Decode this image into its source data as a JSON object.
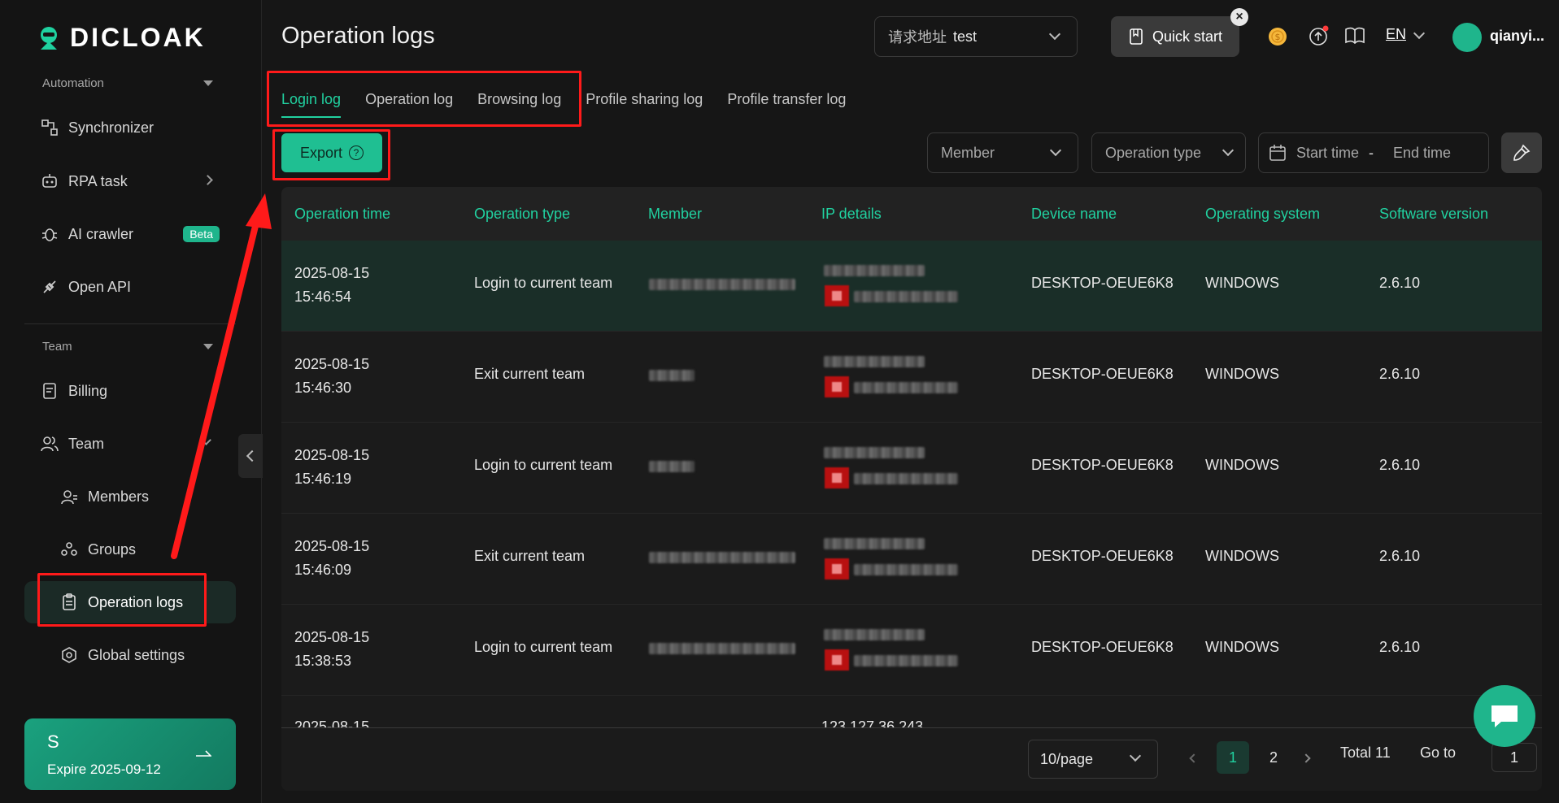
{
  "sidebar": {
    "logo_text": "DICLOAK",
    "automation_label": "Automation",
    "items_automation": [
      {
        "label": "Synchronizer",
        "icon": "sync-icon"
      },
      {
        "label": "RPA task",
        "icon": "robot-icon"
      },
      {
        "label": "AI crawler",
        "icon": "bug-icon",
        "badge": "Beta"
      },
      {
        "label": "Open API",
        "icon": "plug-icon"
      }
    ],
    "team_label": "Team",
    "items_team": [
      {
        "label": "Billing",
        "icon": "billing-icon"
      },
      {
        "label": "Team",
        "icon": "users-icon"
      },
      {
        "label": "Members",
        "icon": "member-icon"
      },
      {
        "label": "Groups",
        "icon": "groups-icon"
      },
      {
        "label": "Operation logs",
        "icon": "clipboard-icon"
      },
      {
        "label": "Global settings",
        "icon": "settings-icon"
      }
    ],
    "plan": {
      "letter": "S",
      "expire": "Expire 2025-09-12"
    }
  },
  "header": {
    "title": "Operation logs",
    "address_label": "请求地址",
    "address_value": "test",
    "quick_start": "Quick start",
    "close": "×",
    "language": "EN",
    "username": "qianyi..."
  },
  "tabs": [
    "Login log",
    "Operation log",
    "Browsing log",
    "Profile sharing log",
    "Profile transfer log"
  ],
  "toolbar": {
    "export_label": "Export",
    "help_glyph": "?",
    "member_placeholder": "Member",
    "operation_type_placeholder": "Operation type",
    "start_time": "Start time",
    "range_sep": "-",
    "end_time": "End time"
  },
  "table": {
    "columns": [
      "Operation time",
      "Operation type",
      "Member",
      "IP details",
      "Device name",
      "Operating system",
      "Software version"
    ],
    "rows": [
      {
        "date": "2025-08-15",
        "time": "15:46:54",
        "type": "Login to current team",
        "device": "DESKTOP-OEUE6K8",
        "os": "WINDOWS",
        "version": "2.6.10"
      },
      {
        "date": "2025-08-15",
        "time": "15:46:30",
        "type": "Exit current team",
        "device": "DESKTOP-OEUE6K8",
        "os": "WINDOWS",
        "version": "2.6.10"
      },
      {
        "date": "2025-08-15",
        "time": "15:46:19",
        "type": "Login to current team",
        "device": "DESKTOP-OEUE6K8",
        "os": "WINDOWS",
        "version": "2.6.10"
      },
      {
        "date": "2025-08-15",
        "time": "15:46:09",
        "type": "Exit current team",
        "device": "DESKTOP-OEUE6K8",
        "os": "WINDOWS",
        "version": "2.6.10"
      },
      {
        "date": "2025-08-15",
        "time": "15:38:53",
        "type": "Login to current team",
        "device": "DESKTOP-OEUE6K8",
        "os": "WINDOWS",
        "version": "2.6.10"
      }
    ],
    "partial_row_date": "2025-08-15",
    "partial_row_ip": "123.127.36.243"
  },
  "pagination": {
    "page_size": "10/page",
    "pages": [
      "1",
      "2"
    ],
    "current_page": "1",
    "total": "Total 11",
    "goto_label": "Go to",
    "goto_value": "1"
  },
  "colors": {
    "accent": "#21d1a0",
    "annotation": "#ff1a1a"
  }
}
